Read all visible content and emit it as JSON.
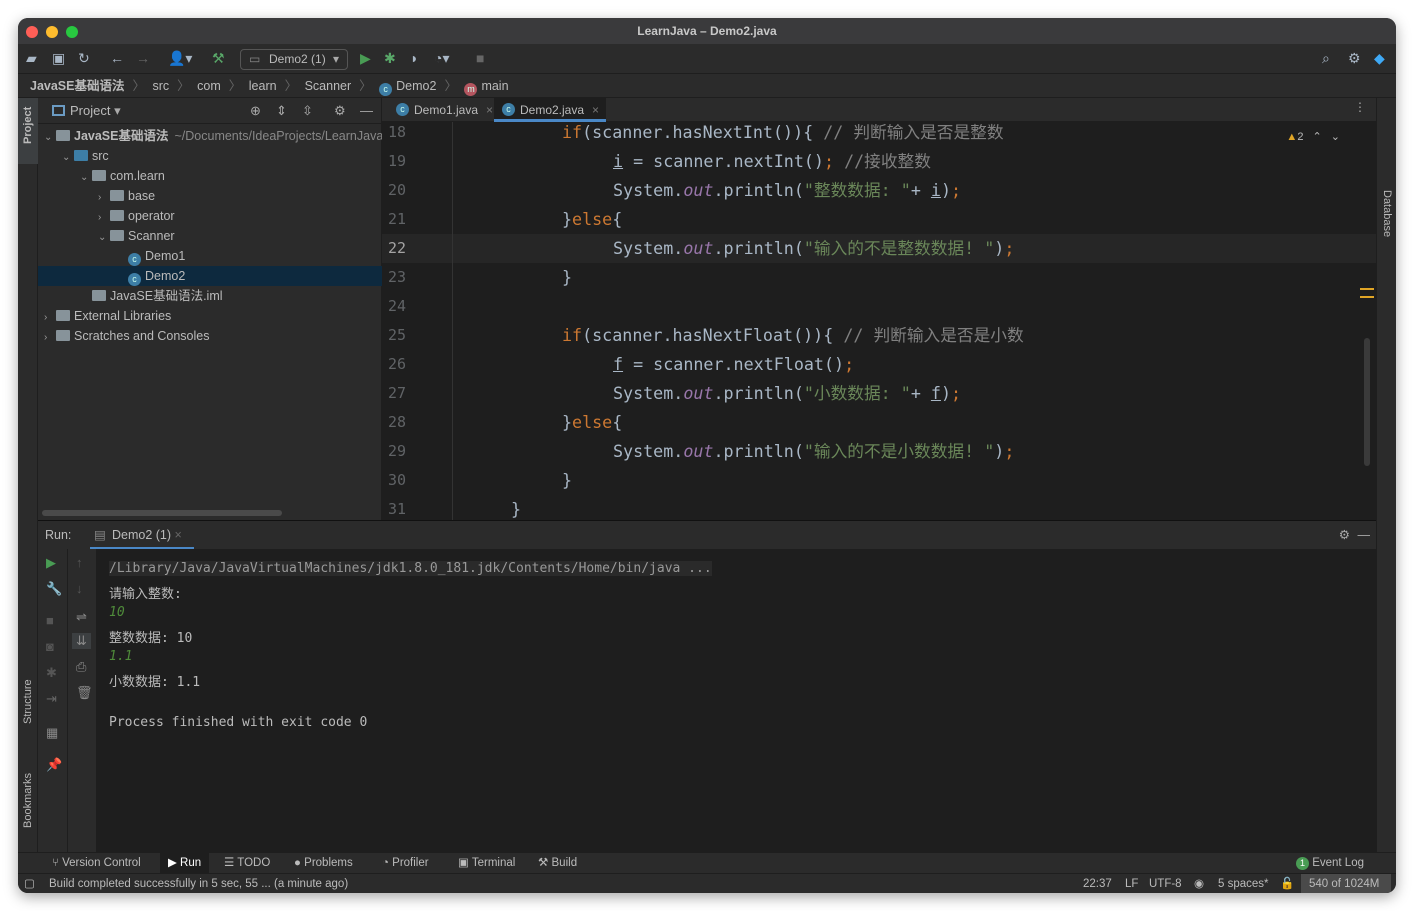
{
  "window": {
    "title": "LearnJava – Demo2.java"
  },
  "toolbar": {
    "run_config": "Demo2 (1)"
  },
  "breadcrumb": [
    "JavaSE基础语法",
    "src",
    "com",
    "learn",
    "Scanner",
    "Demo2",
    "main"
  ],
  "left_strip": {
    "project": "Project",
    "structure": "Structure",
    "bookmarks": "Bookmarks"
  },
  "right_strip": {
    "database": "Database"
  },
  "project": {
    "title": "Project",
    "tree": [
      {
        "label": "JavaSE基础语法",
        "extra": "~/Documents/IdeaProjects/LearnJava",
        "depth": 0,
        "chev": "v",
        "icon": "module"
      },
      {
        "label": "src",
        "depth": 1,
        "chev": "v",
        "icon": "src"
      },
      {
        "label": "com.learn",
        "depth": 2,
        "chev": "v",
        "icon": "package"
      },
      {
        "label": "base",
        "depth": 3,
        "chev": ">",
        "icon": "package"
      },
      {
        "label": "operator",
        "depth": 3,
        "chev": ">",
        "icon": "package"
      },
      {
        "label": "Scanner",
        "depth": 3,
        "chev": "v",
        "icon": "package"
      },
      {
        "label": "Demo1",
        "depth": 4,
        "chev": "",
        "icon": "class"
      },
      {
        "label": "Demo2",
        "depth": 4,
        "chev": "",
        "icon": "class",
        "selected": true
      },
      {
        "label": "JavaSE基础语法.iml",
        "depth": 2,
        "chev": "",
        "icon": "file"
      },
      {
        "label": "External Libraries",
        "depth": 0,
        "chev": ">",
        "icon": "lib"
      },
      {
        "label": "Scratches and Consoles",
        "depth": 0,
        "chev": ">",
        "icon": "scratch"
      }
    ]
  },
  "editor": {
    "tabs": [
      {
        "label": "Demo1.java",
        "active": false
      },
      {
        "label": "Demo2.java",
        "active": true
      }
    ],
    "warnings": "2",
    "current_line": 22,
    "lines": [
      {
        "n": "18",
        "indent": 3,
        "tokens": [
          [
            "kw",
            "if"
          ],
          [
            "",
            "(scanner.hasNextInt()){ "
          ],
          [
            "cm",
            "// 判断输入是否是整数"
          ]
        ]
      },
      {
        "n": "19",
        "indent": 4,
        "tokens": [
          [
            "var",
            "i"
          ],
          [
            "",
            " = scanner.nextInt()"
          ],
          [
            "kw",
            ";"
          ],
          [
            "cm",
            " //接收整数"
          ]
        ]
      },
      {
        "n": "20",
        "indent": 4,
        "tokens": [
          [
            "",
            "System."
          ],
          [
            "fld",
            "out"
          ],
          [
            "",
            ".println("
          ],
          [
            "str",
            "\"整数数据: \""
          ],
          [
            "",
            "+ "
          ],
          [
            "var",
            "i"
          ],
          [
            "",
            ")"
          ],
          [
            "kw",
            ";"
          ]
        ]
      },
      {
        "n": "21",
        "indent": 3,
        "tokens": [
          [
            "",
            "}"
          ],
          [
            "kw",
            "else"
          ],
          [
            "",
            "{"
          ]
        ]
      },
      {
        "n": "22",
        "indent": 4,
        "tokens": [
          [
            "",
            "System."
          ],
          [
            "fld",
            "out"
          ],
          [
            "",
            ".println("
          ],
          [
            "str",
            "\"输入的不是整数数据! \""
          ],
          [
            "",
            ")"
          ],
          [
            "kw",
            ";"
          ]
        ]
      },
      {
        "n": "23",
        "indent": 3,
        "tokens": [
          [
            "",
            "}"
          ]
        ]
      },
      {
        "n": "24",
        "indent": 0,
        "tokens": []
      },
      {
        "n": "25",
        "indent": 3,
        "tokens": [
          [
            "kw",
            "if"
          ],
          [
            "",
            "(scanner.hasNextFloat()){ "
          ],
          [
            "cm",
            "// 判断输入是否是小数"
          ]
        ]
      },
      {
        "n": "26",
        "indent": 4,
        "tokens": [
          [
            "var",
            "f"
          ],
          [
            "",
            " = scanner.nextFloat()"
          ],
          [
            "kw",
            ";"
          ]
        ]
      },
      {
        "n": "27",
        "indent": 4,
        "tokens": [
          [
            "",
            "System."
          ],
          [
            "fld",
            "out"
          ],
          [
            "",
            ".println("
          ],
          [
            "str",
            "\"小数数据: \""
          ],
          [
            "",
            "+ "
          ],
          [
            "var",
            "f"
          ],
          [
            "",
            ")"
          ],
          [
            "kw",
            ";"
          ]
        ]
      },
      {
        "n": "28",
        "indent": 3,
        "tokens": [
          [
            "",
            "}"
          ],
          [
            "kw",
            "else"
          ],
          [
            "",
            "{"
          ]
        ]
      },
      {
        "n": "29",
        "indent": 4,
        "tokens": [
          [
            "",
            "System."
          ],
          [
            "fld",
            "out"
          ],
          [
            "",
            ".println("
          ],
          [
            "str",
            "\"输入的不是小数数据! \""
          ],
          [
            "",
            ")"
          ],
          [
            "kw",
            ";"
          ]
        ]
      },
      {
        "n": "30",
        "indent": 3,
        "tokens": [
          [
            "",
            "}"
          ]
        ]
      },
      {
        "n": "31",
        "indent": 2,
        "tokens": [
          [
            "",
            "}"
          ]
        ]
      }
    ]
  },
  "run": {
    "label": "Run:",
    "tab": "Demo2 (1)",
    "console": [
      {
        "text": "/Library/Java/JavaVirtualMachines/jdk1.8.0_181.jdk/Contents/Home/bin/java ...",
        "type": "cmd"
      },
      {
        "text": "请输入整数:",
        "type": "out"
      },
      {
        "text": "10",
        "type": "in"
      },
      {
        "text": "整数数据: 10",
        "type": "out"
      },
      {
        "text": "1.1",
        "type": "in"
      },
      {
        "text": "小数数据: 1.1",
        "type": "out"
      },
      {
        "text": "",
        "type": "out"
      },
      {
        "text": "Process finished with exit code 0",
        "type": "out"
      }
    ]
  },
  "tool_windows": [
    "Version Control",
    "Run",
    "TODO",
    "Problems",
    "Profiler",
    "Terminal",
    "Build"
  ],
  "event_log": {
    "label": "Event Log",
    "count": "1"
  },
  "status": {
    "message": "Build completed successfully in 5 sec, 55 ... (a minute ago)",
    "position": "22:37",
    "line_sep": "LF",
    "encoding": "UTF-8",
    "indent": "5 spaces*",
    "memory": "540 of 1024M"
  },
  "colors": {
    "keyword": "#cc7832",
    "string": "#6a8759",
    "field": "#9876aa",
    "comment": "#808080",
    "selection": "#0d293e",
    "accent": "#4a88c7"
  }
}
